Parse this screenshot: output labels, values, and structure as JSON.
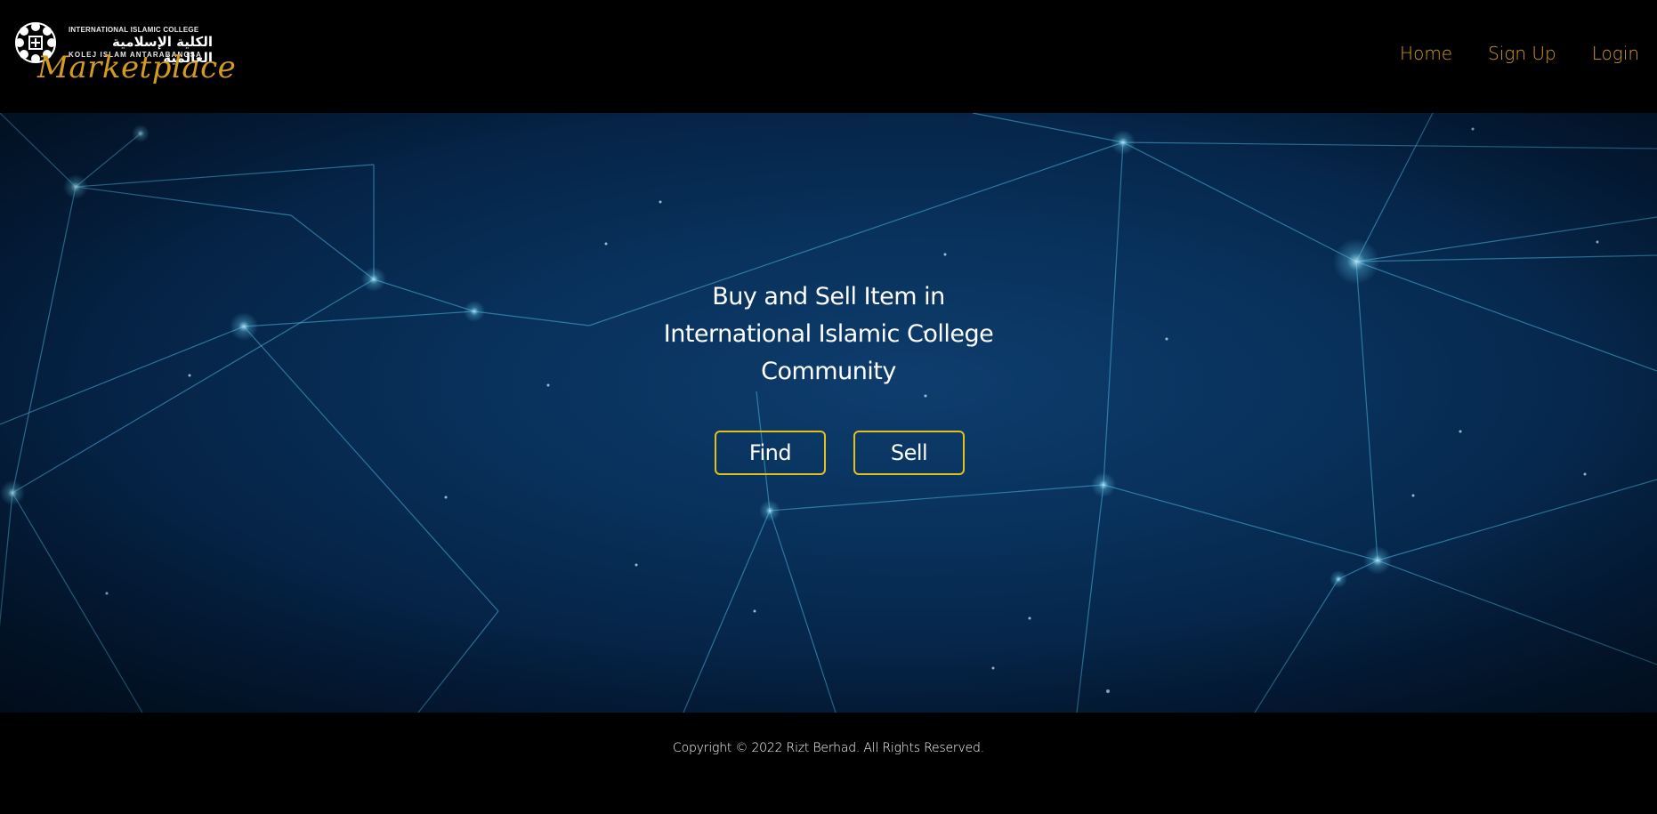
{
  "header": {
    "logo": {
      "english_line": "INTERNATIONAL ISLAMIC COLLEGE",
      "arabic_line": "الكلية الإسلامية العالمية",
      "malay_line": "KOLEJ ISLAM ANTARABANGSA",
      "script_text": "Marketplace"
    },
    "nav": [
      {
        "label": "Home"
      },
      {
        "label": "Sign Up"
      },
      {
        "label": "Login"
      }
    ]
  },
  "hero": {
    "title_lines": [
      "Buy and Sell Item in",
      "International Islamic College",
      "Community"
    ],
    "buttons": [
      {
        "label": "Find"
      },
      {
        "label": "Sell"
      }
    ]
  },
  "footer": {
    "copyright": "Copyright © 2022 Rizt Berhad. All Rights Reserved."
  },
  "colors": {
    "accent_gold": "#d39b1f",
    "button_border_yellow": "#e2c11c",
    "hero_blue": "#08305a",
    "header_bg": "#000000"
  }
}
